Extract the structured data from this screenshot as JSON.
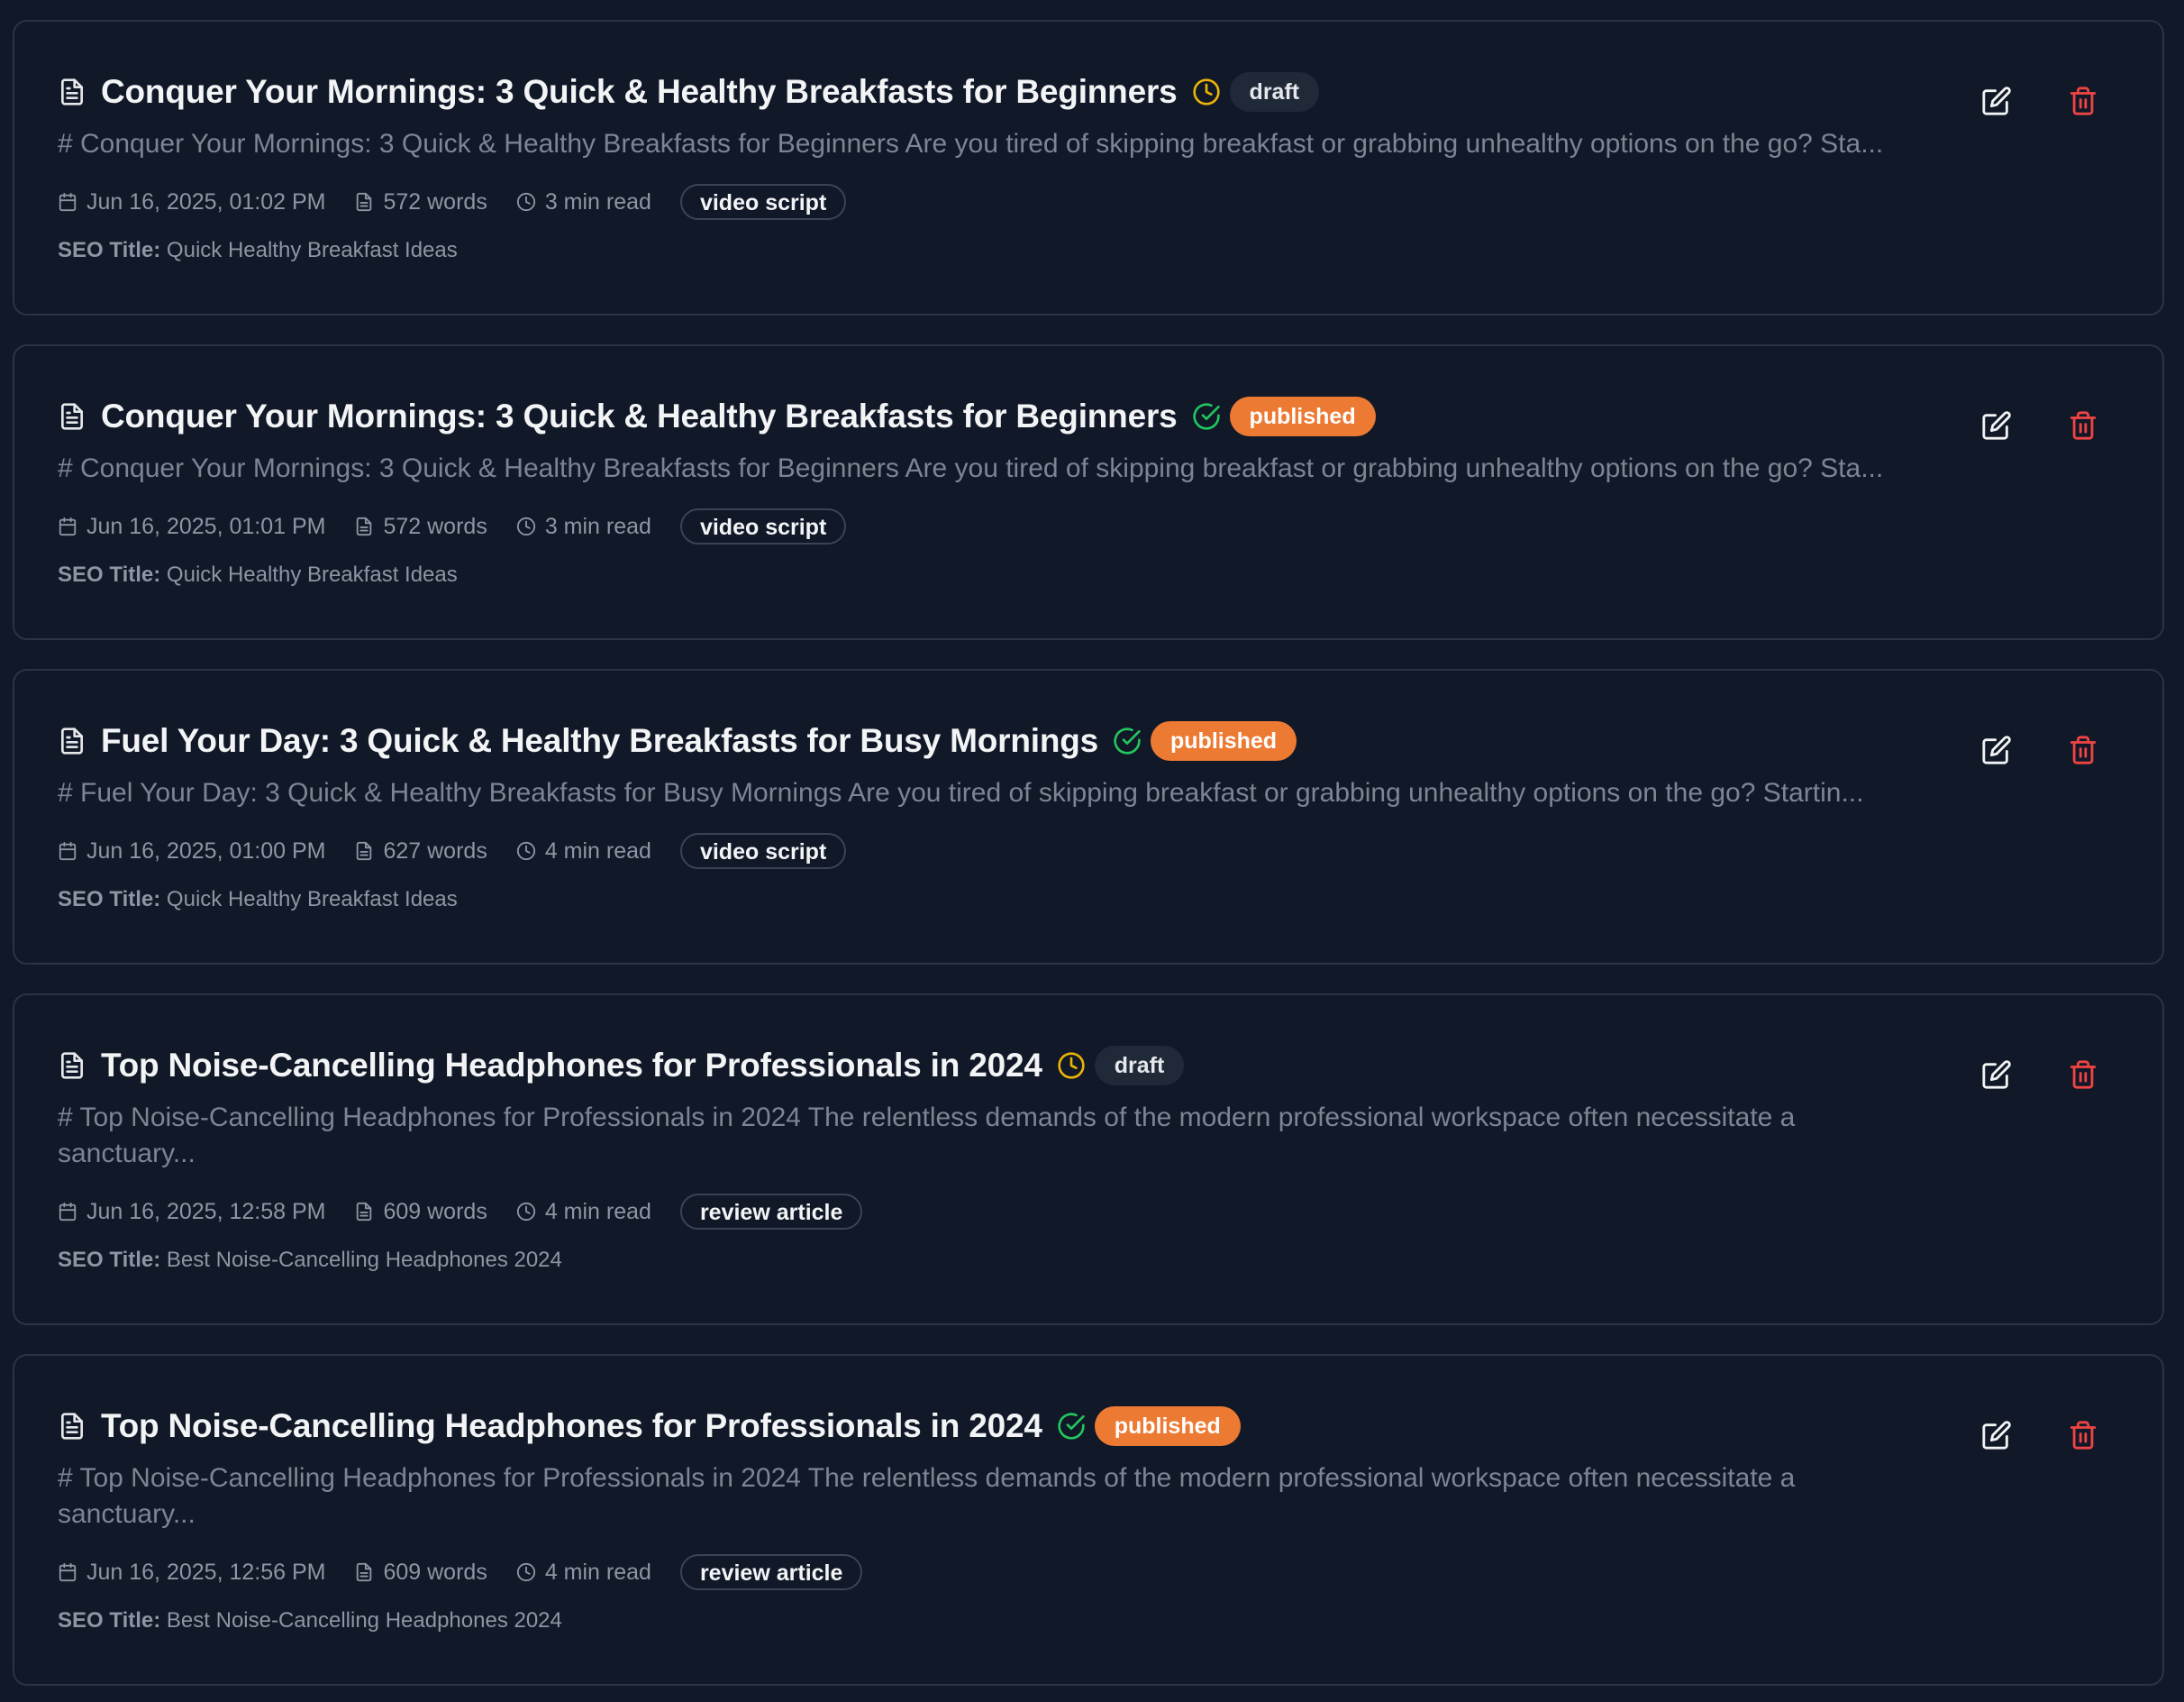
{
  "colors": {
    "background": "#111827",
    "card_border": "#2b3443",
    "draft_icon": "#eab308",
    "published_icon": "#22c55e",
    "published_badge": "#ec7a33",
    "delete_icon": "#ef4444"
  },
  "icons": {
    "document": "document-icon",
    "draft": "clock-icon",
    "published": "check-circle-icon",
    "date": "calendar-icon",
    "words": "document-icon",
    "read_time": "clock-icon",
    "edit": "edit-icon",
    "delete": "trash-icon"
  },
  "seo_label": "SEO Title:",
  "articles": [
    {
      "title": "Conquer Your Mornings: 3 Quick & Healthy Breakfasts for Beginners",
      "status": "draft",
      "excerpt": "# Conquer Your Mornings: 3 Quick & Healthy Breakfasts for Beginners Are you tired of skipping breakfast or grabbing unhealthy options on the go? Sta...",
      "date": "Jun 16, 2025, 01:02 PM",
      "words": "572 words",
      "read_time": "3 min read",
      "type": "video script",
      "seo_title": "Quick Healthy Breakfast Ideas"
    },
    {
      "title": "Conquer Your Mornings: 3 Quick & Healthy Breakfasts for Beginners",
      "status": "published",
      "excerpt": "# Conquer Your Mornings: 3 Quick & Healthy Breakfasts for Beginners Are you tired of skipping breakfast or grabbing unhealthy options on the go? Sta...",
      "date": "Jun 16, 2025, 01:01 PM",
      "words": "572 words",
      "read_time": "3 min read",
      "type": "video script",
      "seo_title": "Quick Healthy Breakfast Ideas"
    },
    {
      "title": "Fuel Your Day: 3 Quick & Healthy Breakfasts for Busy Mornings",
      "status": "published",
      "excerpt": "# Fuel Your Day: 3 Quick & Healthy Breakfasts for Busy Mornings Are you tired of skipping breakfast or grabbing unhealthy options on the go? Startin...",
      "date": "Jun 16, 2025, 01:00 PM",
      "words": "627 words",
      "read_time": "4 min read",
      "type": "video script",
      "seo_title": "Quick Healthy Breakfast Ideas"
    },
    {
      "title": "Top Noise-Cancelling Headphones for Professionals in 2024",
      "status": "draft",
      "excerpt": "# Top Noise-Cancelling Headphones for Professionals in 2024 The relentless demands of the modern professional workspace often necessitate a sanctuary...",
      "date": "Jun 16, 2025, 12:58 PM",
      "words": "609 words",
      "read_time": "4 min read",
      "type": "review article",
      "seo_title": "Best Noise-Cancelling Headphones 2024"
    },
    {
      "title": "Top Noise-Cancelling Headphones for Professionals in 2024",
      "status": "published",
      "excerpt": "# Top Noise-Cancelling Headphones for Professionals in 2024 The relentless demands of the modern professional workspace often necessitate a sanctuary...",
      "date": "Jun 16, 2025, 12:56 PM",
      "words": "609 words",
      "read_time": "4 min read",
      "type": "review article",
      "seo_title": "Best Noise-Cancelling Headphones 2024"
    }
  ]
}
